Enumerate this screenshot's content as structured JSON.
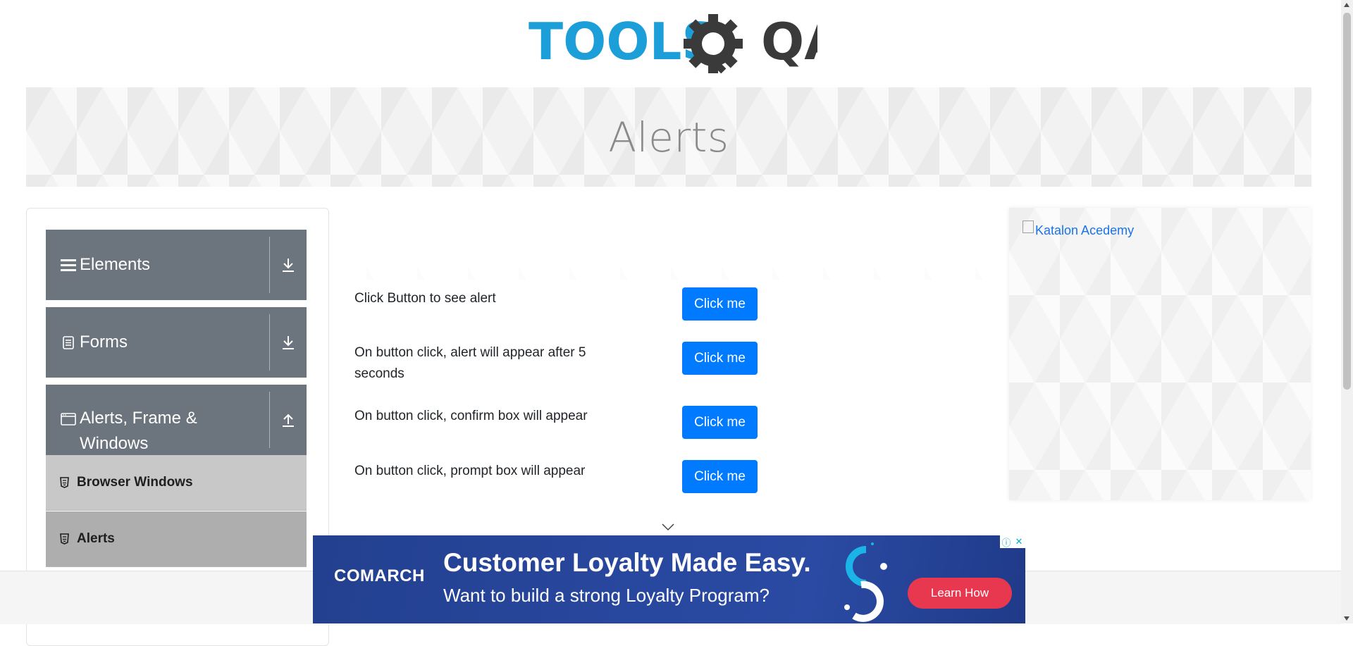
{
  "header": {
    "logo_primary": "TOOLS",
    "logo_secondary": "QA"
  },
  "banner": {
    "title": "Alerts"
  },
  "sidebar": {
    "groups": [
      {
        "label": "Elements",
        "icon": "hamburger-icon",
        "arrow": "download-arrow-icon"
      },
      {
        "label": "Forms",
        "icon": "document-icon",
        "arrow": "download-arrow-icon"
      },
      {
        "label": "Alerts, Frame &",
        "label2": "Windows",
        "icon": "window-icon",
        "arrow": "upload-arrow-icon"
      }
    ],
    "subitems": [
      {
        "label": "Browser Windows",
        "icon": "html5-icon"
      },
      {
        "label": "Alerts",
        "icon": "html5-icon"
      }
    ]
  },
  "main": {
    "rows": [
      {
        "text": "Click Button to see alert",
        "button": "Click me"
      },
      {
        "text": "On button click, alert will appear after 5 seconds",
        "button": "Click me"
      },
      {
        "text": "On button click, confirm box will appear",
        "button": "Click me"
      },
      {
        "text": "On button click, prompt box will appear",
        "button": "Click me"
      }
    ]
  },
  "right_ad": {
    "alt_text": "Katalon Acedemy"
  },
  "bottom_ad": {
    "brand": "COMARCH",
    "headline": "Customer Loyalty Made Easy.",
    "subline": "Want to build a strong Loyalty Program?",
    "cta": "Learn How",
    "info_icon": "ⓘ",
    "close_icon": "✕"
  },
  "colors": {
    "logo_blue": "#1c9fd8",
    "logo_dark": "#3a3a3a",
    "sidebar_group": "#6c757d",
    "button_primary": "#007bff",
    "ad_cta": "#e8384f"
  }
}
